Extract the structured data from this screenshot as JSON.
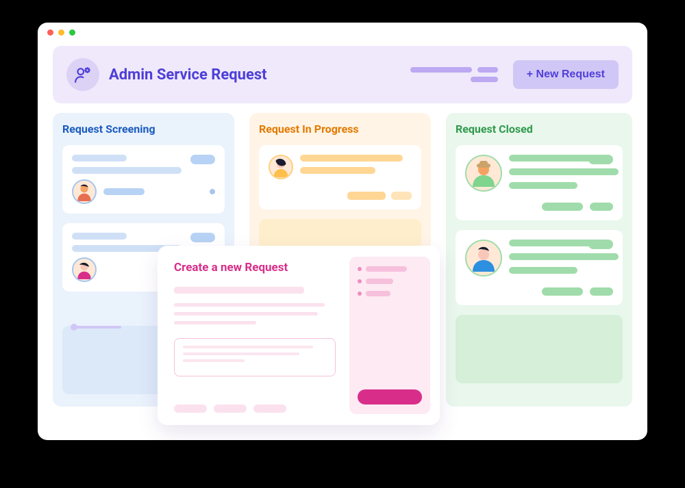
{
  "header": {
    "title": "Admin Service Request",
    "icon": "user-gear-icon",
    "new_request_btn": "+ New Request"
  },
  "columns": {
    "screening": {
      "title": "Request Screening"
    },
    "progress": {
      "title": "Request In Progress"
    },
    "closed": {
      "title": "Request Closed"
    }
  },
  "modal": {
    "title": "Create a new Request"
  }
}
